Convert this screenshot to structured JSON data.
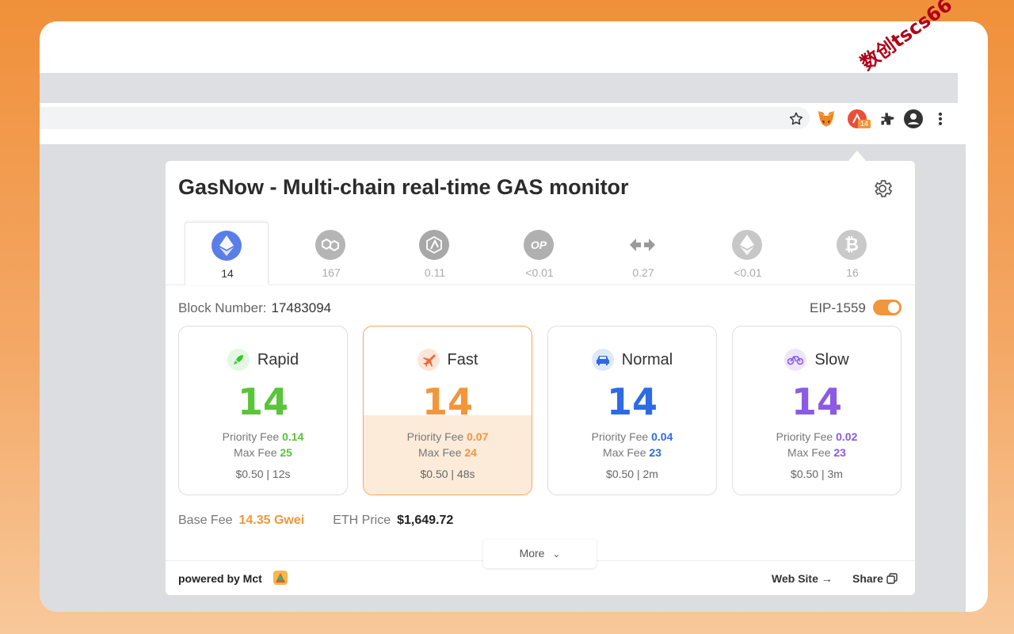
{
  "watermark": "数创tscs66",
  "toolbar": {
    "icons": [
      "star-icon",
      "metamask-fox-icon",
      "gasnow-extension-icon",
      "puzzle-icon",
      "profile-icon",
      "more-vert-icon"
    ],
    "badge": "14"
  },
  "popup": {
    "title": "GasNow - Multi-chain real-time GAS monitor",
    "chains": [
      {
        "icon": "ethereum-icon",
        "value": "14"
      },
      {
        "icon": "polygon-icon",
        "value": "167"
      },
      {
        "icon": "arbitrum-icon",
        "value": "0.11"
      },
      {
        "icon": "optimism-icon",
        "value": "<0.01",
        "glyph": "OP"
      },
      {
        "icon": "bridge-arrows-icon",
        "value": "0.27"
      },
      {
        "icon": "ethereum-gray-icon",
        "value": "<0.01"
      },
      {
        "icon": "bitcoin-icon",
        "value": "16"
      }
    ],
    "block_label": "Block Number:",
    "block_number": "17483094",
    "eip_label": "EIP-1559",
    "eip_enabled": true,
    "priority_label": "Priority Fee",
    "max_label": "Max Fee",
    "cards": [
      {
        "name": "Rapid",
        "icon": "rocket-icon",
        "value": "14",
        "priority": "0.14",
        "max": "25",
        "footer": "$0.50 | 12s",
        "color": "#5ac43a"
      },
      {
        "name": "Fast",
        "icon": "plane-icon",
        "value": "14",
        "priority": "0.07",
        "max": "24",
        "footer": "$0.50 | 48s",
        "color": "#f2963b"
      },
      {
        "name": "Normal",
        "icon": "car-icon",
        "value": "14",
        "priority": "0.04",
        "max": "23",
        "footer": "$0.50 | 2m",
        "color": "#2e6ae6"
      },
      {
        "name": "Slow",
        "icon": "bicycle-icon",
        "value": "14",
        "priority": "0.02",
        "max": "23",
        "footer": "$0.50 | 3m",
        "color": "#8b5ae6"
      }
    ],
    "base_fee_label": "Base Fee",
    "base_fee": "14.35 Gwei",
    "eth_price_label": "ETH Price",
    "eth_price": "$1,649.72",
    "more_label": "More",
    "powered_by": "powered by Mct",
    "website_label": "Web Site",
    "share_label": "Share"
  }
}
